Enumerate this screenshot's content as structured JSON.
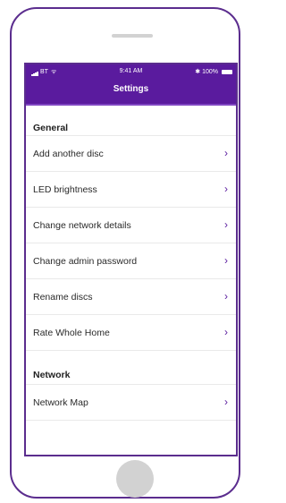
{
  "statusbar": {
    "carrier": "BT",
    "time": "9:41 AM",
    "battery": "100%"
  },
  "navbar": {
    "title": "Settings"
  },
  "sections": {
    "general": {
      "header": "General",
      "items": [
        {
          "label": "Add another disc"
        },
        {
          "label": "LED brightness"
        },
        {
          "label": "Change network details"
        },
        {
          "label": "Change admin password"
        },
        {
          "label": "Rename discs"
        },
        {
          "label": "Rate Whole Home"
        }
      ]
    },
    "network": {
      "header": "Network",
      "items": [
        {
          "label": "Network Map"
        }
      ]
    }
  },
  "icons": {
    "signal": "signal-bars-icon",
    "wifi": "wifi-icon",
    "battery": "battery-icon",
    "chevron": "chevron-right-icon"
  },
  "colors": {
    "brand": "#5a1b9e",
    "frame": "#5b2d8e",
    "home_button": "#d2d2d2"
  }
}
